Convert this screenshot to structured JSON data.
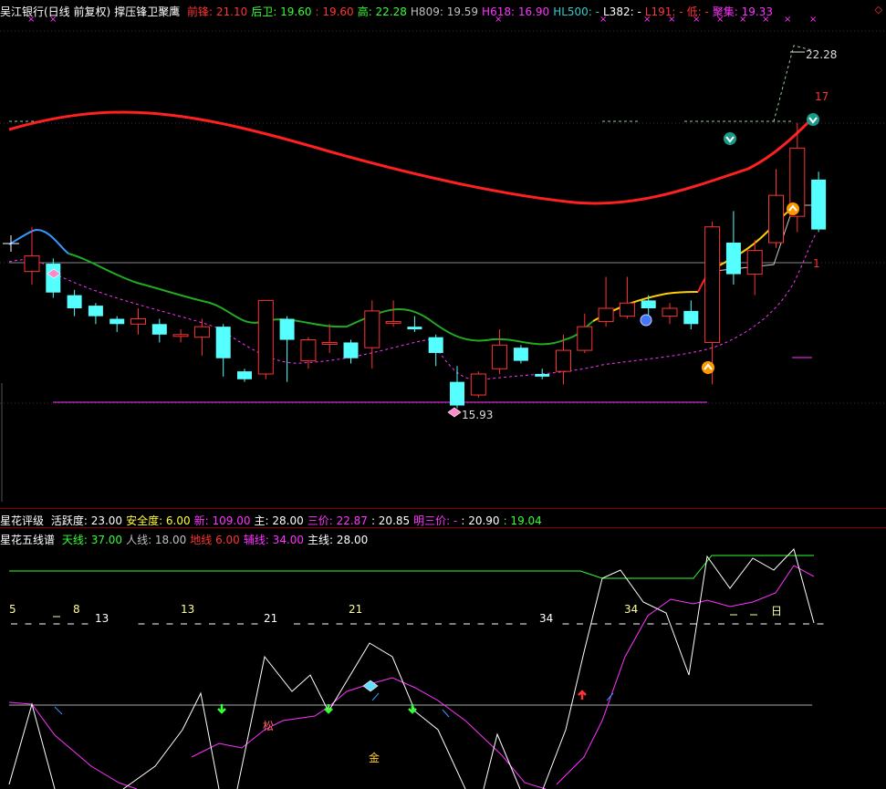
{
  "header": {
    "stock": "吴江银行(日线 前复权)",
    "indicator": "撑压锋卫聚鹰",
    "items": [
      {
        "label": "前锋: 21.10",
        "color": "#ff3333"
      },
      {
        "label": "后卫: 19.60",
        "color": "#33ff33"
      },
      {
        "label": ": 19.60",
        "color": "#ff3333"
      },
      {
        "label": "高: 22.28",
        "color": "#33ff33"
      },
      {
        "label": "H809: 19.59",
        "color": "#c0c0c0"
      },
      {
        "label": "H618: 16.90",
        "color": "#ff33ff"
      },
      {
        "label": "HL500: -",
        "color": "#33cccc"
      },
      {
        "label": "L382: -",
        "color": "#ffffff"
      },
      {
        "label": "L191: -",
        "color": "#ff3333"
      },
      {
        "label": "低: -",
        "color": "#ff3333"
      },
      {
        "label": "聚集: 19.33",
        "color": "#ff33ff"
      }
    ],
    "corner_mark": "◇"
  },
  "main_labels": {
    "high_price": "22.28",
    "low_price": "15.93",
    "count_17": "17",
    "count_1": "1"
  },
  "rating_bar": {
    "title": "星花评级",
    "items": [
      {
        "label": "活跃度: 23.00",
        "color": "#ffffff"
      },
      {
        "label": "安全度: 6.00",
        "color": "#ffff33"
      },
      {
        "label": "新: 109.00",
        "color": "#ff33ff"
      },
      {
        "label": "主: 28.00",
        "color": "#ffffff"
      },
      {
        "label": "三价: 22.87",
        "color": "#ff33ff"
      },
      {
        "label": ": 20.85",
        "color": "#ffffff"
      },
      {
        "label": "明三价: -",
        "color": "#ff33ff"
      },
      {
        "label": ": 20.90",
        "color": "#ffffff"
      },
      {
        "label": ": 19.04",
        "color": "#33ff33"
      }
    ]
  },
  "five_line_bar": {
    "title": "星花五线谱",
    "items": [
      {
        "label": "天线: 37.00",
        "color": "#33ff33"
      },
      {
        "label": "人线: 18.00",
        "color": "#c0c0c0"
      },
      {
        "label": "地线 6.00",
        "color": "#ff3333"
      },
      {
        "label": "辅线: 34.00",
        "color": "#ff33ff"
      },
      {
        "label": "主线: 28.00",
        "color": "#ffffff"
      }
    ]
  },
  "lower_labels": {
    "numbers": [
      "5",
      "8",
      "13",
      "13",
      "21",
      "21",
      "34",
      "34"
    ],
    "song": "松",
    "jin": "金",
    "ri": "日"
  },
  "colors": {
    "up_candle": "#ff3333",
    "down_candle": "#55ffff",
    "red_curve": "#ff2020",
    "blue_curve": "#3399ff",
    "green_curve": "#22aa22",
    "yellow_curve": "#ffcc00",
    "magenta": "#ff33ff",
    "white_line": "#ffffff",
    "green_line": "#33ff33"
  },
  "candles": [
    {
      "o": 19.45,
      "c": 19.75,
      "h": 20.3,
      "l": 19.2
    },
    {
      "o": 19.6,
      "c": 19.05,
      "h": 19.7,
      "l": 18.95
    },
    {
      "o": 19.0,
      "c": 18.75,
      "h": 19.1,
      "l": 18.6
    },
    {
      "o": 18.8,
      "c": 18.6,
      "h": 18.85,
      "l": 18.45
    },
    {
      "o": 18.55,
      "c": 18.45,
      "h": 18.6,
      "l": 18.3
    },
    {
      "o": 18.45,
      "c": 18.55,
      "h": 18.75,
      "l": 18.25
    },
    {
      "o": 18.45,
      "c": 18.25,
      "h": 18.55,
      "l": 18.1
    },
    {
      "o": 18.25,
      "c": 18.25,
      "h": 18.35,
      "l": 18.1
    },
    {
      "o": 18.2,
      "c": 18.4,
      "h": 18.55,
      "l": 17.85
    },
    {
      "o": 18.4,
      "c": 17.8,
      "h": 18.45,
      "l": 17.45
    },
    {
      "o": 17.55,
      "c": 17.4,
      "h": 17.6,
      "l": 17.35
    },
    {
      "o": 17.5,
      "c": 18.9,
      "h": 18.9,
      "l": 17.4
    },
    {
      "o": 18.55,
      "c": 18.15,
      "h": 18.6,
      "l": 17.35
    },
    {
      "o": 17.75,
      "c": 18.15,
      "h": 18.2,
      "l": 17.6
    },
    {
      "o": 18.1,
      "c": 18.1,
      "h": 18.45,
      "l": 17.9
    },
    {
      "o": 18.1,
      "c": 17.8,
      "h": 18.15,
      "l": 17.7
    },
    {
      "o": 18.0,
      "c": 18.7,
      "h": 18.9,
      "l": 17.6
    },
    {
      "o": 18.5,
      "c": 18.5,
      "h": 18.9,
      "l": 18.4
    },
    {
      "o": 18.4,
      "c": 18.35,
      "h": 18.6,
      "l": 18.3
    },
    {
      "o": 18.2,
      "c": 17.9,
      "h": 18.25,
      "l": 17.65
    },
    {
      "o": 17.35,
      "c": 16.9,
      "h": 17.65,
      "l": 16.85
    },
    {
      "o": 17.1,
      "c": 17.5,
      "h": 17.55,
      "l": 17.05
    },
    {
      "o": 17.6,
      "c": 18.05,
      "h": 18.35,
      "l": 17.5
    },
    {
      "o": 18.0,
      "c": 17.75,
      "h": 18.05,
      "l": 17.7
    },
    {
      "o": 17.5,
      "c": 17.45,
      "h": 17.6,
      "l": 17.4
    },
    {
      "o": 17.55,
      "c": 17.95,
      "h": 18.25,
      "l": 17.3
    },
    {
      "o": 17.95,
      "c": 18.4,
      "h": 18.65,
      "l": 17.9
    },
    {
      "o": 18.5,
      "c": 18.75,
      "h": 19.35,
      "l": 18.4
    },
    {
      "o": 18.6,
      "c": 18.85,
      "h": 19.35,
      "l": 18.55
    },
    {
      "o": 18.9,
      "c": 18.75,
      "h": 19.0,
      "l": 18.5
    },
    {
      "o": 18.6,
      "c": 18.75,
      "h": 18.85,
      "l": 18.45
    },
    {
      "o": 18.7,
      "c": 18.45,
      "h": 18.9,
      "l": 18.35
    },
    {
      "o": 18.1,
      "c": 20.3,
      "h": 20.4,
      "l": 17.3
    },
    {
      "o": 20.0,
      "c": 19.4,
      "h": 20.6,
      "l": 19.2
    },
    {
      "o": 19.4,
      "c": 19.85,
      "h": 20.05,
      "l": 19.0
    },
    {
      "o": 20.0,
      "c": 20.9,
      "h": 21.4,
      "l": 19.9
    },
    {
      "o": 20.5,
      "c": 21.8,
      "h": 22.28,
      "l": 20.2
    },
    {
      "o": 21.2,
      "c": 20.25,
      "h": 21.35,
      "l": 20.2
    }
  ]
}
